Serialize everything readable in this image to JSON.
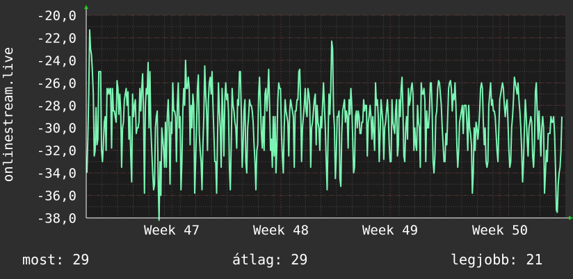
{
  "chart_data": {
    "type": "line",
    "ylabel": "onlinestream.live",
    "ylim": [
      -38.0,
      -20.0
    ],
    "yticks": [
      "-20,0",
      "-22,0",
      "-24,0",
      "-26,0",
      "-28,0",
      "-30,0",
      "-32,0",
      "-34,0",
      "-36,0",
      "-38,0"
    ],
    "xticks": [
      "Week 47",
      "Week 48",
      "Week 49",
      "Week 50"
    ],
    "grid": true,
    "colors": {
      "line": "#7cf5b4",
      "grid_major": "#5a2a2a",
      "grid_minor": "#4a4a4a",
      "background": "#1c1c1c",
      "arrow": "#22cc22"
    },
    "series": [
      {
        "values": [
          -34,
          -31,
          -27,
          -21.3,
          -23,
          -23.5,
          -25,
          -27,
          -32.5,
          -32,
          -28.2,
          -31.5,
          -31,
          -25,
          -25,
          -25,
          -32,
          -33,
          -31.5,
          -29.5,
          -29,
          -32,
          -26.5,
          -27,
          -26.5,
          -27,
          -26.5,
          -31.8,
          -26.5,
          -28.5,
          -28.5,
          -29,
          -29.5,
          -25.8,
          -26.5,
          -28.8,
          -27,
          -28.5,
          -33.5,
          -30,
          -29.5,
          -27.5,
          -27,
          -26.5,
          -28,
          -26.8,
          -31,
          -29,
          -32.5,
          -34.8,
          -27,
          -29,
          -28,
          -27.5,
          -30.5,
          -30,
          -30,
          -29.5,
          -26.5,
          -28.5,
          -26.5,
          -25.2,
          -29,
          -35.8,
          -28,
          -26.5,
          -27,
          -24.2,
          -30,
          -25,
          -30,
          -32,
          -34,
          -35.5,
          -35,
          -30,
          -29,
          -28.5,
          -34.5,
          -38.2,
          -33,
          -36,
          -30,
          -31,
          -32,
          -33.5,
          -29.5,
          -33.5,
          -29,
          -27.5,
          -30,
          -35,
          -29.5,
          -30.5,
          -26,
          -28.5,
          -28.5,
          -29,
          -33,
          -28,
          -26,
          -30,
          -29,
          -35.5,
          -33,
          -28.5,
          -26.5,
          -28,
          -24,
          -26.5,
          -26.5,
          -25.5,
          -26.5,
          -31.5,
          -28,
          -30,
          -27,
          -28,
          -35.8,
          -33,
          -30,
          -26.5,
          -25.3,
          -30.5,
          -32,
          -33,
          -35.5,
          -31.5,
          -29,
          -24.5,
          -27,
          -28.5,
          -32,
          -27.5,
          -26,
          -25.5,
          -27,
          -25,
          -28,
          -30.5,
          -33,
          -33,
          -35.8,
          -31,
          -26,
          -28.5,
          -30,
          -33.5,
          -26.5,
          -29,
          -32.5,
          -27.5,
          -26,
          -27.5,
          -27,
          -28.5,
          -33.5,
          -35.5,
          -31.5,
          -26.5,
          -28,
          -28.5,
          -29.5,
          -30,
          -31.8,
          -27.5,
          -28,
          -25,
          -25,
          -28.5,
          -33.5,
          -31.5,
          -28.5,
          -27.5,
          -33,
          -34,
          -30,
          -29,
          -27.5,
          -28,
          -28,
          -28.5,
          -29.5,
          -31.5,
          -33,
          -35.5,
          -32,
          -31.5,
          -27,
          -25.5,
          -28,
          -30.5,
          -31.8,
          -29,
          -32,
          -27,
          -26.5,
          -28.5,
          -27,
          -24.8,
          -28,
          -32,
          -31,
          -33.5,
          -29,
          -32.5,
          -29,
          -34,
          -31.5,
          -27.5,
          -26,
          -26.5,
          -26.5,
          -30.5,
          -32.5,
          -34,
          -30,
          -27.5,
          -28.5,
          -29,
          -29.5,
          -32.5,
          -28.5,
          -27.5,
          -28,
          -28.5,
          -29,
          -33.5,
          -28.5,
          -28.5,
          -27.5,
          -27.5,
          -25,
          -24.8,
          -28,
          -33,
          -30,
          -29,
          -28,
          -26.5,
          -28.5,
          -29,
          -26.5,
          -27,
          -28,
          -33.5,
          -30,
          -29.5,
          -28.5,
          -27.5,
          -27,
          -31.5,
          -28,
          -29.5,
          -30,
          -32,
          -29,
          -30,
          -28,
          -26,
          -28,
          -30,
          -33,
          -35.5,
          -31,
          -27,
          -28.8,
          -26.5,
          -22.3,
          -23,
          -28.5,
          -30,
          -34.5,
          -32.5,
          -29,
          -29,
          -28.5,
          -34.5,
          -35.2,
          -30.5,
          -28.5,
          -28,
          -27.5,
          -29.5,
          -28.5,
          -29,
          -31.8,
          -27.5,
          -28.8,
          -26.5,
          -28,
          -31,
          -34,
          -33.5,
          -29,
          -28.5,
          -30,
          -28.5,
          -29,
          -30.5,
          -30.5,
          -29.5,
          -29.5,
          -27.5,
          -28.5,
          -28,
          -28,
          -32.5,
          -29.5,
          -29,
          -28,
          -29,
          -31,
          -29,
          -30.5,
          -32,
          -26,
          -28,
          -27.5,
          -29,
          -33,
          -30.5,
          -27.5,
          -28.5,
          -29.5,
          -32.8,
          -30,
          -29.5,
          -28.5,
          -27.5,
          -29,
          -31.5,
          -33,
          -33,
          -27.5,
          -29.5,
          -30,
          -30.5,
          -28.5,
          -27.5,
          -32.5,
          -31.5,
          -27.5,
          -29,
          -26.5,
          -25.5,
          -28.5,
          -32.5,
          -33,
          -30,
          -29,
          -31,
          -26.5,
          -28,
          -27.5,
          -26.5,
          -26,
          -27,
          -32,
          -30,
          -31.5,
          -32,
          -28,
          -29.5,
          -30,
          -33.5,
          -26,
          -27,
          -27,
          -26.5,
          -27.5,
          -33,
          -28.5,
          -30,
          -30,
          -28.5,
          -26,
          -26,
          -28.5,
          -33,
          -34,
          -32.5,
          -29,
          -28.5,
          -26.5,
          -25.8,
          -26,
          -27,
          -28,
          -30,
          -31.5,
          -33,
          -33,
          -30.5,
          -31.5,
          -29,
          -26.5,
          -26,
          -25.8,
          -26.5,
          -28.5,
          -27,
          -27.5,
          -26,
          -28,
          -31.5,
          -33.5,
          -32,
          -29.5,
          -29,
          -28.5,
          -28,
          -30.5,
          -28,
          -28,
          -28,
          -29.5,
          -32,
          -28,
          -30,
          -30.5,
          -31.5,
          -35.8,
          -34,
          -30,
          -32,
          -29.5,
          -30,
          -31,
          -30,
          -28.5,
          -26.5,
          -26,
          -26.5,
          -29.5,
          -31.5,
          -30,
          -33,
          -33.5,
          -33,
          -28,
          -27,
          -26,
          -28,
          -27.5,
          -28.5,
          -28.5,
          -29,
          -30.5,
          -32,
          -33,
          -30,
          -27.5,
          -27,
          -26.5,
          -26,
          -26.5,
          -28,
          -29,
          -28,
          -27.5,
          -29.5,
          -32,
          -33.5,
          -33,
          -30,
          -29,
          -27.5,
          -25.5,
          -26,
          -26.5,
          -27,
          -26,
          -27.5,
          -28.5,
          -30,
          -32,
          -34.8,
          -33,
          -30,
          -27.5,
          -29,
          -31,
          -32.5,
          -30,
          -29.5,
          -29,
          -29.5,
          -32.5,
          -33.5,
          -31.5,
          -26.8,
          -26,
          -28.5,
          -31,
          -28.5,
          -30.5,
          -32.5,
          -30,
          -29,
          -30,
          -35.8,
          -34,
          -32,
          -33,
          -30.5,
          -30.5,
          -30.5,
          -29,
          -29.5,
          -29.5,
          -29,
          -30.5,
          -33.5,
          -37.3,
          -37.5,
          -35,
          -34,
          -33.5,
          -32,
          -29
        ]
      }
    ]
  },
  "footer": {
    "current": "most: 29",
    "average": "átlag: 29",
    "best": "legjobb: 21"
  }
}
